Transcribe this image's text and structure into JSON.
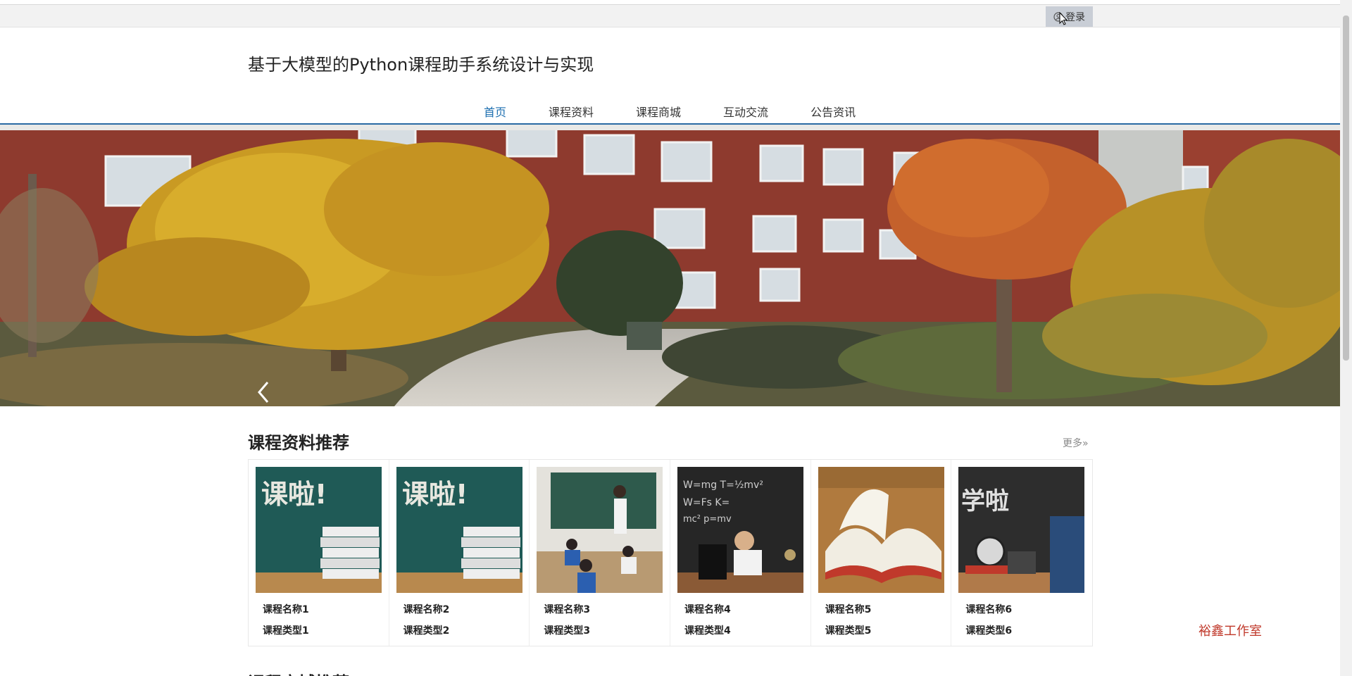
{
  "topbar": {
    "login_label": "登录",
    "login_icon": "user-icon"
  },
  "header": {
    "site_title": "基于大模型的Python课程助手系统设计与实现"
  },
  "nav": {
    "items": [
      {
        "label": "首页",
        "active": true
      },
      {
        "label": "课程资料",
        "active": false
      },
      {
        "label": "课程商城",
        "active": false
      },
      {
        "label": "互动交流",
        "active": false
      },
      {
        "label": "公告资讯",
        "active": false
      }
    ],
    "accent_color": "#1d6fb0"
  },
  "banner": {
    "slide_count": 3,
    "active_slide": 3
  },
  "course_section": {
    "title": "课程资料推荐",
    "more_label": "更多»",
    "cards": [
      {
        "name": "课程名称1",
        "type": "课程类型1"
      },
      {
        "name": "课程名称2",
        "type": "课程类型2"
      },
      {
        "name": "课程名称3",
        "type": "课程类型3"
      },
      {
        "name": "课程名称4",
        "type": "课程类型4"
      },
      {
        "name": "课程名称5",
        "type": "课程类型5"
      },
      {
        "name": "课程名称6",
        "type": "课程类型6"
      }
    ]
  },
  "next_section": {
    "title": "课程商城推荐"
  },
  "footer_badge": {
    "label": "裕鑫工作室",
    "color": "#c0392b"
  }
}
